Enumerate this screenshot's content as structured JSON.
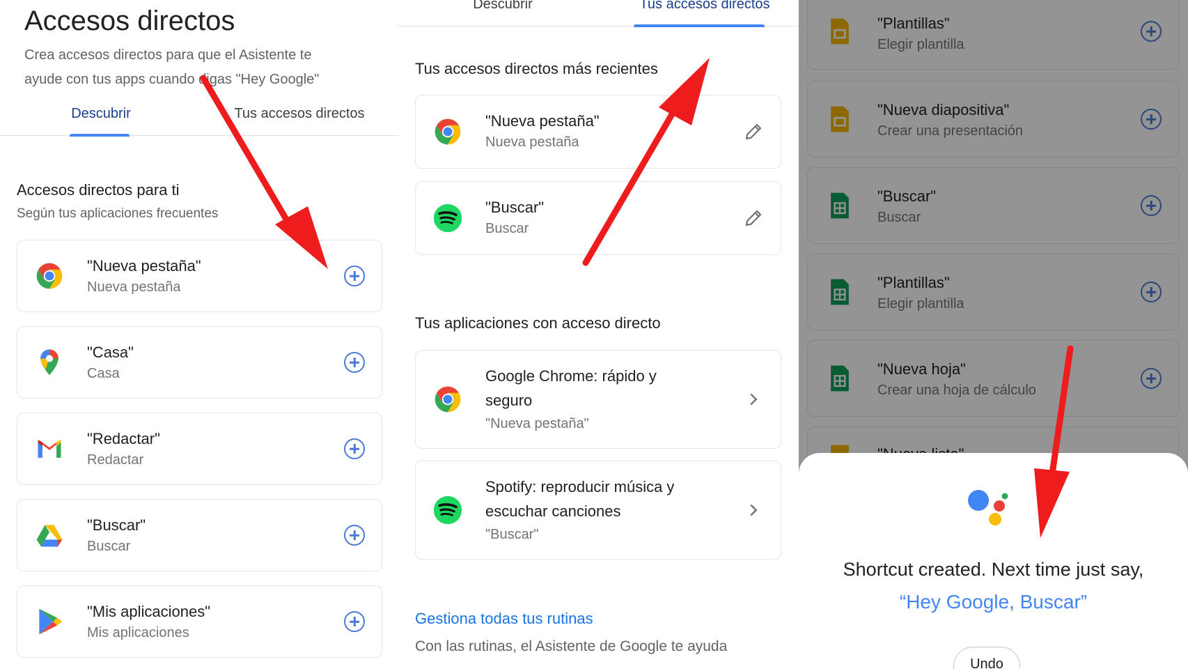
{
  "colors": {
    "accent": "#4285f4",
    "link": "#1a73e8",
    "arrow": "#ee1c1c"
  },
  "p1": {
    "title": "Accesos directos",
    "subtitle": "Crea accesos directos para que el Asistente te ayude con tus apps cuando digas \"Hey Google\"",
    "tab_discover": "Descubrir",
    "tab_yours": "Tus accesos directos",
    "section_title": "Accesos directos para ti",
    "section_sub": "Según tus aplicaciones frecuentes",
    "cards": [
      {
        "icon": "chrome-icon",
        "title": "\"Nueva pestaña\"",
        "sub": "Nueva pestaña"
      },
      {
        "icon": "maps-icon",
        "title": "\"Casa\"",
        "sub": "Casa"
      },
      {
        "icon": "gmail-icon",
        "title": "\"Redactar\"",
        "sub": "Redactar"
      },
      {
        "icon": "drive-icon",
        "title": "\"Buscar\"",
        "sub": "Buscar"
      },
      {
        "icon": "play-store-icon",
        "title": "\"Mis aplicaciones\"",
        "sub": "Mis aplicaciones"
      }
    ]
  },
  "p2": {
    "tab_discover": "Descubrir",
    "tab_yours": "Tus accesos directos",
    "recent_title": "Tus accesos directos más recientes",
    "recent": [
      {
        "icon": "chrome-icon",
        "title": "\"Nueva pestaña\"",
        "sub": "Nueva pestaña"
      },
      {
        "icon": "spotify-icon",
        "title": "\"Buscar\"",
        "sub": "Buscar"
      }
    ],
    "apps_title": "Tus aplicaciones con acceso directo",
    "apps": [
      {
        "icon": "chrome-icon",
        "line1": "Google Chrome: rápido y",
        "line2": "seguro",
        "sub": "\"Nueva pestaña\""
      },
      {
        "icon": "spotify-icon",
        "line1": "Spotify: reproducir música y",
        "line2": "escuchar canciones",
        "sub": "\"Buscar\""
      }
    ],
    "routines_link": "Gestiona todas tus rutinas",
    "routines_text": "Con las rutinas, el Asistente de Google te ayuda"
  },
  "p3": {
    "cards": [
      {
        "icon": "slides-icon",
        "title": "\"Plantillas\"",
        "sub": "Elegir plantilla"
      },
      {
        "icon": "slides-icon",
        "title": "\"Nueva diapositiva\"",
        "sub": "Crear una presentación"
      },
      {
        "icon": "sheets-icon",
        "title": "\"Buscar\"",
        "sub": "Buscar"
      },
      {
        "icon": "sheets-icon",
        "title": "\"Plantillas\"",
        "sub": "Elegir plantilla"
      },
      {
        "icon": "sheets-icon",
        "title": "\"Nueva hoja\"",
        "sub": "Crear una hoja de cálculo"
      }
    ],
    "partial_card_title": "\"Nueva lista\"",
    "sheet": {
      "message": "Shortcut created. Next time just say,",
      "quote": "“Hey Google, Buscar”",
      "undo": "Undo"
    }
  }
}
